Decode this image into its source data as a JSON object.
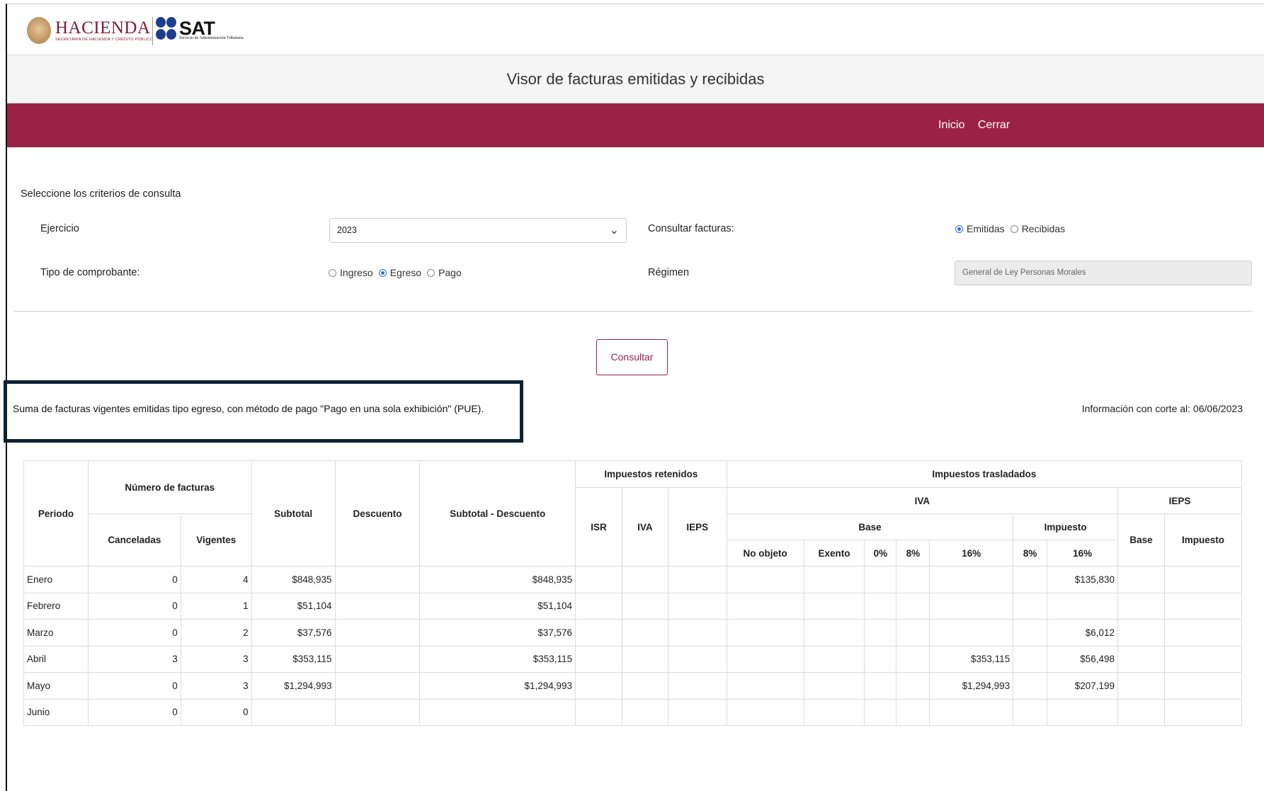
{
  "header": {
    "hacienda_title": "HACIENDA",
    "hacienda_subtitle": "SECRETARÍA DE HACIENDA Y CRÉDITO PÚBLICO",
    "sat_title": "SAT",
    "sat_subtitle": "Servicio de Administración Tributaria"
  },
  "page_title": "Visor de facturas emitidas y recibidas",
  "nav": {
    "inicio": "Inicio",
    "cerrar": "Cerrar"
  },
  "form": {
    "heading": "Seleccione los criterios de consulta",
    "ejercicio_label": "Ejercicio",
    "ejercicio_value": "2023",
    "consultar_label": "Consultar facturas:",
    "consultar_options": [
      "Emitidas",
      "Recibidas"
    ],
    "consultar_selected": "Emitidas",
    "tipo_label": "Tipo de comprobante:",
    "tipo_options": [
      "Ingreso",
      "Egreso",
      "Pago"
    ],
    "tipo_selected": "Egreso",
    "regimen_label": "Régimen",
    "regimen_value": "General de Ley Personas Morales",
    "submit_label": "Consultar"
  },
  "summary": {
    "text": "Suma de facturas vigentes emitidas tipo egreso, con método de pago \"Pago en una sola exhibición\" (PUE).",
    "corte": "Información con corte al: 06/06/2023"
  },
  "table": {
    "headers": {
      "periodo": "Periodo",
      "numero_facturas": "Número de facturas",
      "canceladas": "Canceladas",
      "vigentes": "Vigentes",
      "subtotal": "Subtotal",
      "descuento": "Descuento",
      "subtotal_descuento": "Subtotal - Descuento",
      "impuestos_retenidos": "Impuestos retenidos",
      "isr": "ISR",
      "iva_ret": "IVA",
      "ieps_ret": "IEPS",
      "impuestos_trasladados": "Impuestos trasladados",
      "iva": "IVA",
      "ieps": "IEPS",
      "base": "Base",
      "impuesto": "Impuesto",
      "no_objeto": "No objeto",
      "exento": "Exento",
      "p0": "0%",
      "p8": "8%",
      "p16": "16%",
      "imp8": "8%",
      "imp16": "16%",
      "ieps_base": "Base",
      "ieps_impuesto": "Impuesto"
    },
    "rows": [
      {
        "periodo": "Enero",
        "canceladas": "0",
        "vigentes": "4",
        "subtotal": "$848,935",
        "descuento": "",
        "subtotal_descuento": "$848,935",
        "base16": "",
        "imp16": "$135,830"
      },
      {
        "periodo": "Febrero",
        "canceladas": "0",
        "vigentes": "1",
        "subtotal": "$51,104",
        "descuento": "",
        "subtotal_descuento": "$51,104",
        "base16": "",
        "imp16": ""
      },
      {
        "periodo": "Marzo",
        "canceladas": "0",
        "vigentes": "2",
        "subtotal": "$37,576",
        "descuento": "",
        "subtotal_descuento": "$37,576",
        "base16": "",
        "imp16": "$6,012"
      },
      {
        "periodo": "Abril",
        "canceladas": "3",
        "vigentes": "3",
        "subtotal": "$353,115",
        "descuento": "",
        "subtotal_descuento": "$353,115",
        "base16": "$353,115",
        "imp16": "$56,498"
      },
      {
        "periodo": "Mayo",
        "canceladas": "0",
        "vigentes": "3",
        "subtotal": "$1,294,993",
        "descuento": "",
        "subtotal_descuento": "$1,294,993",
        "base16": "$1,294,993",
        "imp16": "$207,199"
      },
      {
        "periodo": "Junio",
        "canceladas": "0",
        "vigentes": "0",
        "subtotal": "",
        "descuento": "",
        "subtotal_descuento": "",
        "base16": "",
        "imp16": ""
      }
    ]
  },
  "colors": {
    "brand": "#9a2246",
    "highlight_border": "#0d2233",
    "radio_accent": "#2f6fd6"
  }
}
